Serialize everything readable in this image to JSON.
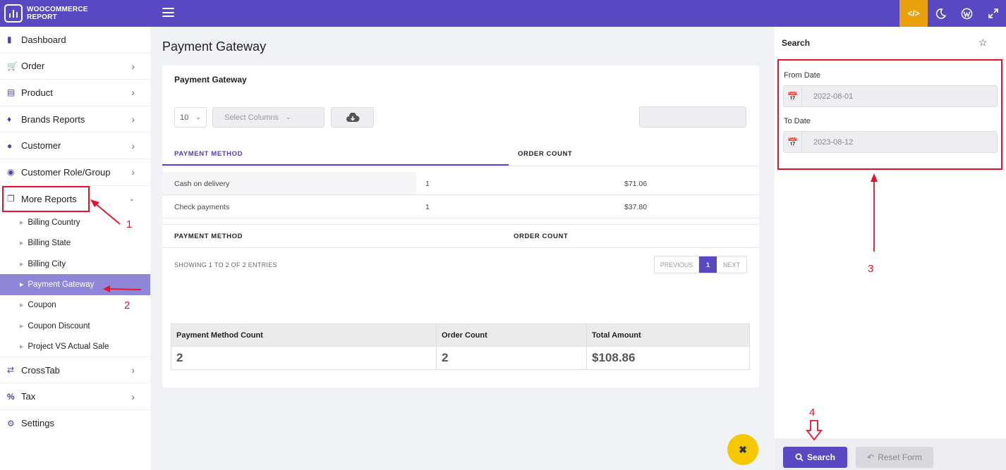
{
  "brand": {
    "line1": "WOOCOMMERCE",
    "line2": "REPORT"
  },
  "topbar": {
    "code_icon": "</>",
    "icons": [
      "code-icon",
      "moon-icon",
      "wordpress-icon",
      "expand-icon"
    ]
  },
  "sidebar": {
    "items": [
      {
        "label": "Dashboard",
        "icon": "bookmark-icon",
        "chevron": false
      },
      {
        "label": "Order",
        "icon": "cart-icon",
        "chevron": true
      },
      {
        "label": "Product",
        "icon": "bag-icon",
        "chevron": true
      },
      {
        "label": "Brands Reports",
        "icon": "tag-icon",
        "chevron": true
      },
      {
        "label": "Customer",
        "icon": "user-icon",
        "chevron": true
      },
      {
        "label": "Customer Role/Group",
        "icon": "user-circle-icon",
        "chevron": true
      },
      {
        "label": "More Reports",
        "icon": "copy-icon",
        "chevron": true,
        "expanded": true
      }
    ],
    "sub_items": [
      "Billing Country",
      "Billing State",
      "Billing City",
      "Payment Gateway",
      "Coupon",
      "Coupon Discount",
      "Project VS Actual Sale"
    ],
    "active_sub": "Payment Gateway",
    "bottom_items": [
      {
        "label": "CrossTab",
        "icon": "shuffle-icon",
        "chevron": true
      },
      {
        "label": "Tax",
        "icon": "percent-icon",
        "chevron": true
      },
      {
        "label": "Settings",
        "icon": "cogs-icon",
        "chevron": false
      }
    ]
  },
  "main": {
    "page_title": "Payment Gateway",
    "card_title": "Payment Gateway",
    "page_length": "10",
    "select_columns": "Select Columns",
    "table": {
      "headers": [
        "PAYMENT METHOD",
        "ORDER COUNT"
      ],
      "rows": [
        [
          "Cash on delivery",
          "1",
          "$71.06"
        ],
        [
          "Check payments",
          "1",
          "$37.80"
        ]
      ],
      "footer_headers": [
        "PAYMENT METHOD",
        "ORDER COUNT"
      ]
    },
    "showing": "SHOWING 1 TO 2 OF 2 ENTRIES",
    "pagination": {
      "previous": "PREVIOUS",
      "current": "1",
      "next": "NEXT"
    },
    "summary": {
      "headers": [
        "Payment Method Count",
        "Order Count",
        "Total Amount"
      ],
      "values": [
        "2",
        "2",
        "$108.86"
      ]
    }
  },
  "search_panel": {
    "title": "Search",
    "from_label": "From Date",
    "from_value": "2022-08-01",
    "to_label": "To Date",
    "to_value": "2023-08-12",
    "search_button": "Search",
    "reset_button": "Reset Form"
  },
  "annotations": [
    "1",
    "2",
    "3",
    "4"
  ],
  "colors": {
    "primary": "#5849c2",
    "accent": "#e8a10a",
    "annotation": "#e8102a",
    "fab": "#f5c800"
  }
}
